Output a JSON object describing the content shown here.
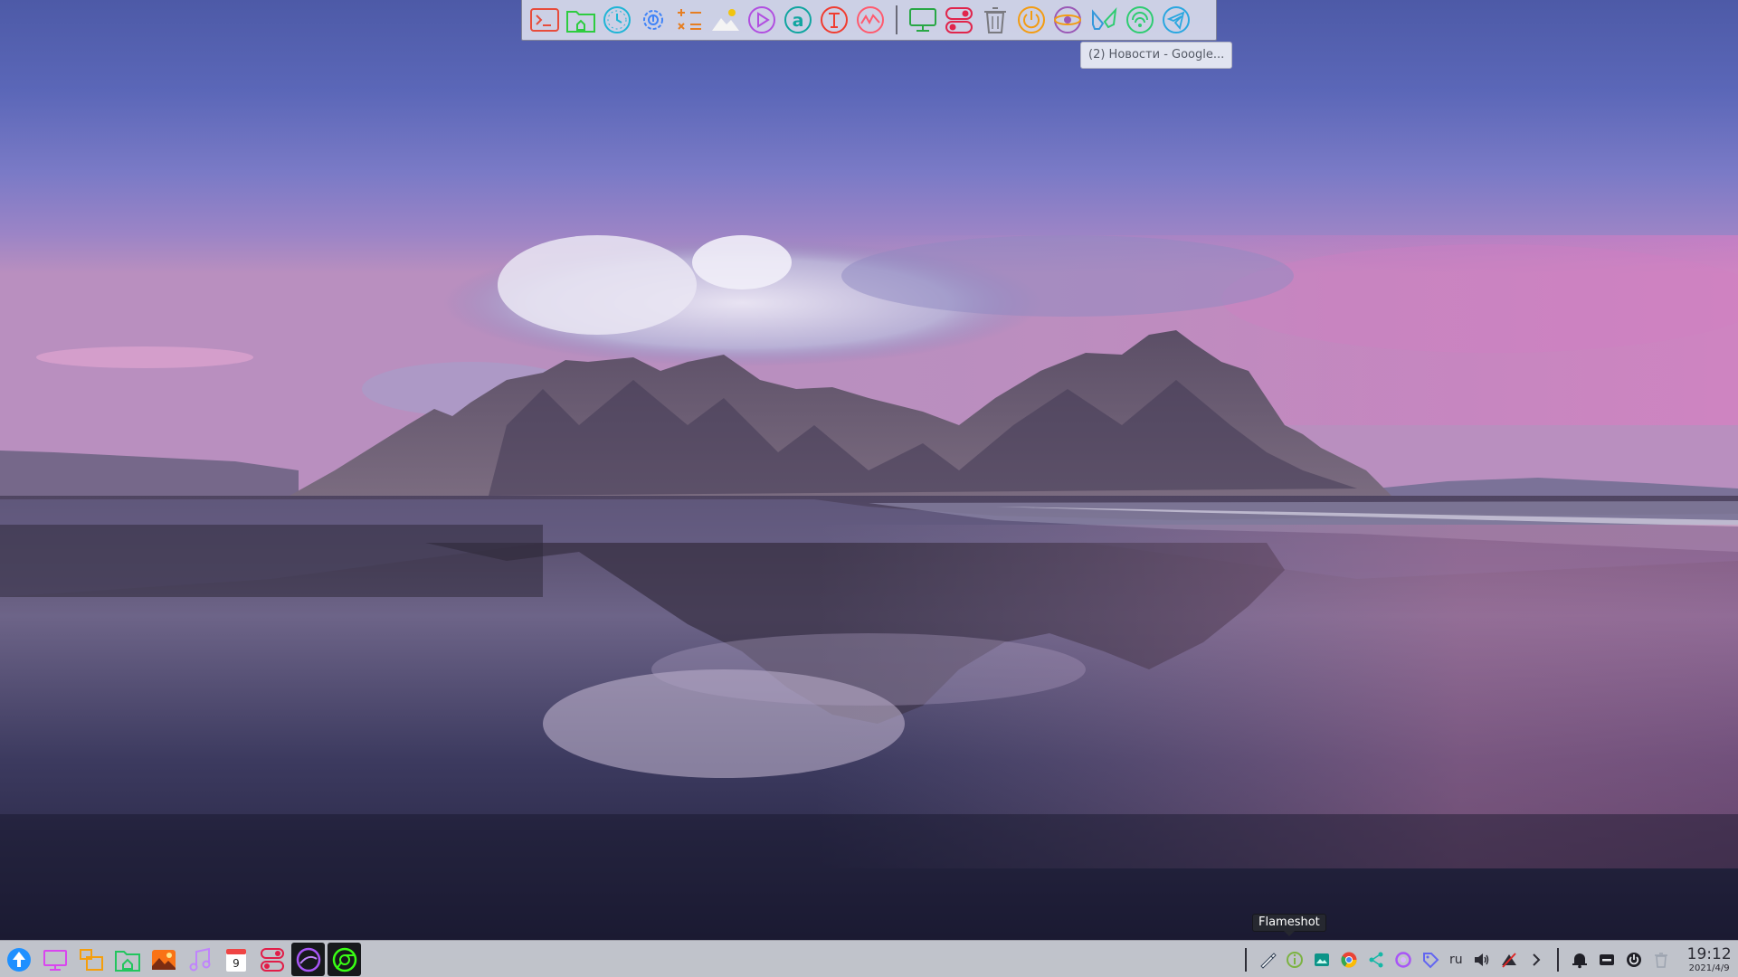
{
  "desktop": {
    "wallpaper": "Mountain range reflected on wet black sand beach at dusk"
  },
  "top_dock": {
    "apps": [
      {
        "name": "terminal-icon",
        "color": "#e74c3c"
      },
      {
        "name": "file-manager-icon",
        "color": "#2ecc40"
      },
      {
        "name": "clock-icon",
        "color": "#1fb5d6"
      },
      {
        "name": "settings-icon",
        "color": "#3f83f8"
      },
      {
        "name": "calculator-icon",
        "color": "#e67e22"
      },
      {
        "name": "image-viewer-icon",
        "color": "#f1c40f"
      },
      {
        "name": "media-player-icon",
        "color": "#b14fe0"
      },
      {
        "name": "app-store-icon",
        "color": "#10a5a0"
      },
      {
        "name": "text-editor-icon",
        "color": "#f03c30"
      },
      {
        "name": "system-monitor-icon",
        "color": "#ff5a6e"
      },
      {
        "name": "remote-desktop-icon",
        "color": "#28a745"
      },
      {
        "name": "toggle-icon",
        "color": "#e0254c"
      },
      {
        "name": "trash-icon",
        "color": "#7a7a80"
      },
      {
        "name": "power-icon",
        "color": "#f39c12"
      },
      {
        "name": "browser-icon",
        "color": "#9b59b6"
      },
      {
        "name": "tools-icon",
        "color": "#3498db"
      },
      {
        "name": "network-icon",
        "color": "#2ecc71"
      },
      {
        "name": "telegram-icon",
        "color": "#2aa7e0"
      }
    ]
  },
  "tooltips": {
    "window": "(2) Новости - Google...",
    "tray": "Flameshot"
  },
  "bottom_panel": {
    "launcher": [
      {
        "name": "app-menu-icon",
        "color": "#1e90ff"
      },
      {
        "name": "workspaces-icon",
        "color": "#d946ef"
      },
      {
        "name": "window-list-icon",
        "color": "#f59e0b"
      },
      {
        "name": "home-folder-icon",
        "color": "#22c55e"
      },
      {
        "name": "photos-icon",
        "color": "#f97316"
      },
      {
        "name": "music-icon",
        "color": "#c084fc"
      },
      {
        "name": "calendar-icon",
        "color": "#ef4444",
        "label": "9"
      },
      {
        "name": "toggle-app-icon",
        "color": "#e11d48"
      },
      {
        "name": "browser-app-icon",
        "color": "#a855f7"
      },
      {
        "name": "chrome-app-icon",
        "color": "#39ff14"
      }
    ],
    "tray": {
      "items": [
        {
          "name": "flameshot-icon",
          "color": "#f8fafc"
        },
        {
          "name": "info-icon",
          "color": "#7cb342"
        },
        {
          "name": "screen-icon",
          "color": "#0d9488"
        },
        {
          "name": "chrome-icon",
          "color": "#ea4335"
        },
        {
          "name": "share-icon",
          "color": "#14b8a6"
        },
        {
          "name": "ring-icon",
          "color": "#a855f7"
        },
        {
          "name": "tag-icon",
          "color": "#6366f1"
        }
      ],
      "language": "ru",
      "volume_icon": "volume-icon",
      "network_icon": "network-disabled-icon",
      "expand_icon": "chevron-right-icon",
      "system_icons": [
        "bell-icon",
        "keyboard-icon",
        "power-icon",
        "trash-icon"
      ]
    },
    "clock": {
      "time": "19:12",
      "date": "2021/4/9"
    }
  }
}
